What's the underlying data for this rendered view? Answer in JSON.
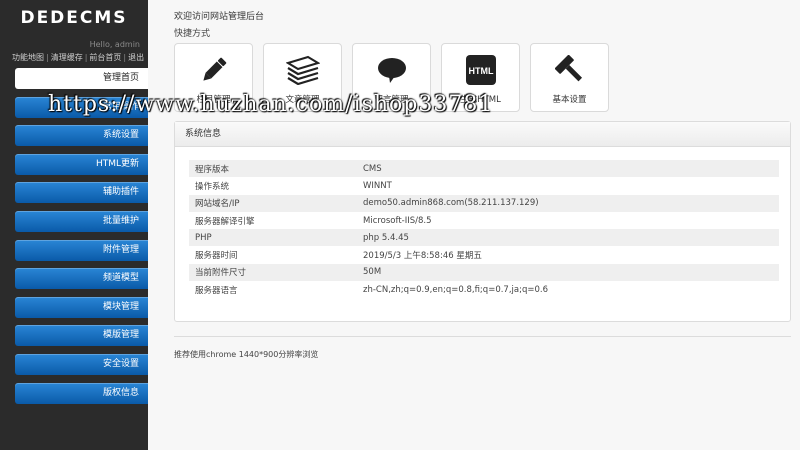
{
  "sidebar": {
    "logo": "DEDECMS",
    "greeting": "Hello, admin",
    "top_links": [
      "功能地图",
      "清理缓存",
      "前台首页",
      "退出"
    ],
    "menu": [
      {
        "label": "管理首页",
        "active": true
      },
      {
        "label": "常用操作",
        "active": false
      },
      {
        "label": "系统设置",
        "active": false
      },
      {
        "label": "HTML更新",
        "active": false
      },
      {
        "label": "辅助插件",
        "active": false
      },
      {
        "label": "批量维护",
        "active": false
      },
      {
        "label": "附件管理",
        "active": false
      },
      {
        "label": "频道模型",
        "active": false
      },
      {
        "label": "模块管理",
        "active": false
      },
      {
        "label": "模版管理",
        "active": false
      },
      {
        "label": "安全设置",
        "active": false
      },
      {
        "label": "版权信息",
        "active": false
      }
    ]
  },
  "main": {
    "welcome": "欢迎访问网站管理后台",
    "quick_label": "快捷方式",
    "shortcuts": [
      {
        "label": "栏目管理",
        "icon": "pencil-icon"
      },
      {
        "label": "文章管理",
        "icon": "document-stack-icon"
      },
      {
        "label": "留言管理",
        "icon": "speech-bubble-icon"
      },
      {
        "label": "生成HTML",
        "icon": "html-icon",
        "icon_text": "HTML"
      },
      {
        "label": "基本设置",
        "icon": "hammer-icon"
      }
    ],
    "system_info": {
      "title": "系统信息",
      "rows": [
        {
          "key": "程序版本",
          "value": "CMS"
        },
        {
          "key": "操作系统",
          "value": "WINNT"
        },
        {
          "key": "网站域名/IP",
          "value": "demo50.admin868.com(58.211.137.129)"
        },
        {
          "key": "服务器解译引擎",
          "value": "Microsoft-IIS/8.5"
        },
        {
          "key": "PHP",
          "value": "php 5.4.45"
        },
        {
          "key": "服务器时间",
          "value": "2019/5/3 上午8:58:46 星期五"
        },
        {
          "key": "当前附件尺寸",
          "value": "50M"
        },
        {
          "key": "服务器语言",
          "value": "zh-CN,zh;q=0.9,en;q=0.8,fi;q=0.7,ja;q=0.6"
        }
      ]
    },
    "footer_note": "推荐使用chrome 1440*900分辨率浏览"
  },
  "watermark": "https://www.huzhan.com/ishop33781"
}
